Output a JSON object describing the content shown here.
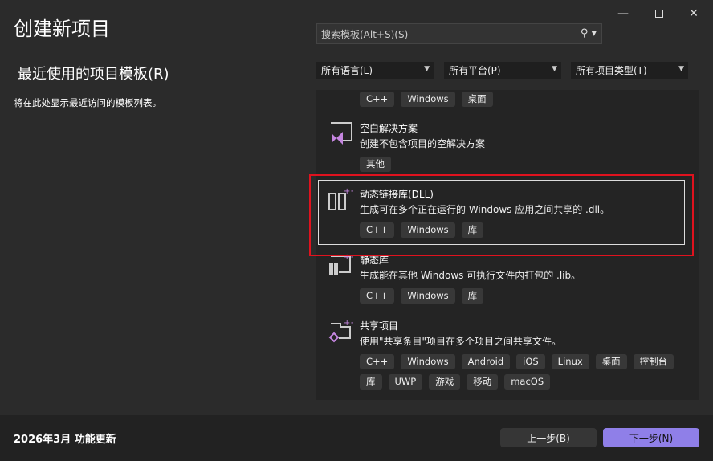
{
  "window": {
    "title": "创建新项目",
    "controls": [
      "minimize",
      "maximize",
      "close"
    ]
  },
  "recent": {
    "heading": "最近使用的项目模板(R)",
    "empty_text": "将在此处显示最近访问的模板列表。"
  },
  "search": {
    "placeholder": "搜索模板(Alt+S)(S)"
  },
  "filters": {
    "language": "所有语言(L)",
    "platform": "所有平台(P)",
    "project_type": "所有项目类型(T)"
  },
  "templates": [
    {
      "name": "",
      "description": "",
      "tags": [
        "C++",
        "Windows",
        "桌面"
      ]
    },
    {
      "name": "空白解决方案",
      "description": "创建不包含项目的空解决方案",
      "tags": [
        "其他"
      ],
      "icon": "blank-solution-icon"
    },
    {
      "name": "动态链接库(DLL)",
      "description": "生成可在多个正在运行的 Windows 应用之间共享的 .dll。",
      "tags": [
        "C++",
        "Windows",
        "库"
      ],
      "icon": "dll-icon",
      "selected": true
    },
    {
      "name": "静态库",
      "description": "生成能在其他 Windows 可执行文件内打包的 .lib。",
      "tags": [
        "C++",
        "Windows",
        "库"
      ],
      "icon": "static-library-icon"
    },
    {
      "name": "共享项目",
      "description": "使用\"共享条目\"项目在多个项目之间共享文件。",
      "tags": [
        "C++",
        "Windows",
        "Android",
        "iOS",
        "Linux",
        "桌面",
        "控制台",
        "库",
        "UWP",
        "游戏",
        "移动",
        "macOS"
      ],
      "icon": "shared-project-icon"
    }
  ],
  "footer": {
    "update": "2026年3月 功能更新",
    "back": "上一步(B)",
    "next": "下一步(N)"
  },
  "colors": {
    "accent": "#8f7fe8",
    "highlight": "#e0121e"
  }
}
